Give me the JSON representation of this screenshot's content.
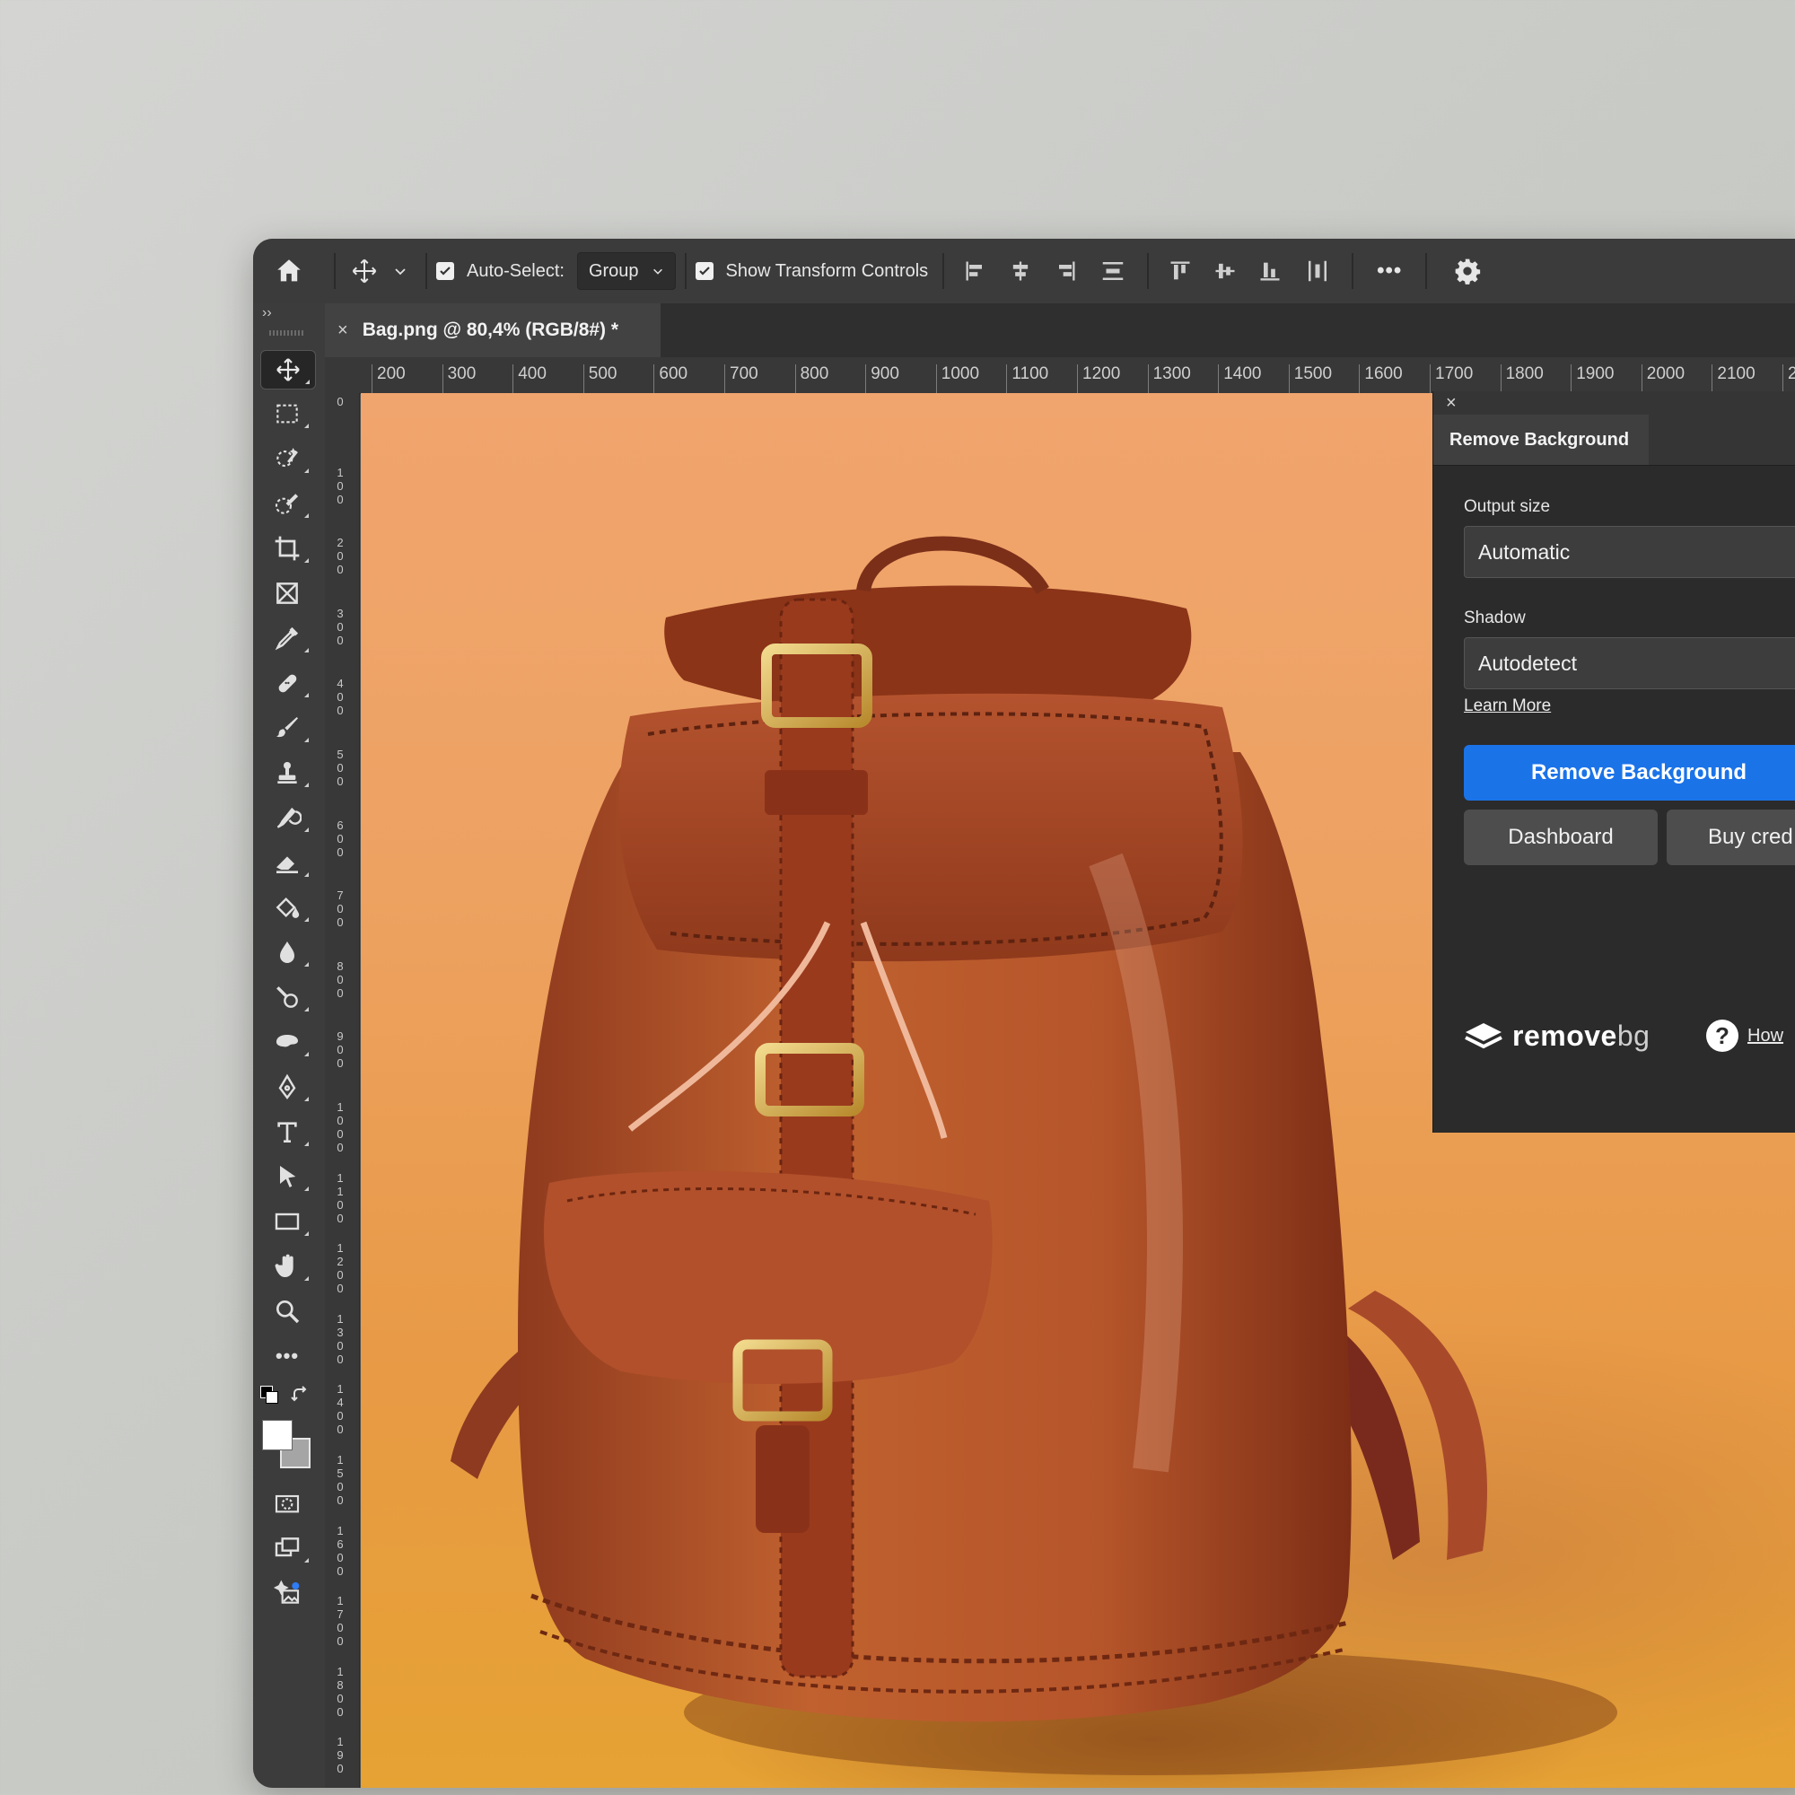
{
  "options_bar": {
    "auto_select_label": "Auto-Select:",
    "auto_select_value": "Group",
    "show_transform_label": "Show Transform Controls",
    "more_label": "•••"
  },
  "document": {
    "tab_close": "×",
    "tab_title": "Bag.png @ 80,4% (RGB/8#) *"
  },
  "rulers": {
    "top": [
      "200",
      "300",
      "400",
      "500",
      "600",
      "700",
      "800",
      "900",
      "1000",
      "1100",
      "1200",
      "1300",
      "1400",
      "1500",
      "1600",
      "1700",
      "1800",
      "1900",
      "2000",
      "2100",
      "2"
    ],
    "left": [
      [
        "0"
      ],
      [
        "1",
        "0",
        "0"
      ],
      [
        "2",
        "0",
        "0"
      ],
      [
        "3",
        "0",
        "0"
      ],
      [
        "4",
        "0",
        "0"
      ],
      [
        "5",
        "0",
        "0"
      ],
      [
        "6",
        "0",
        "0"
      ],
      [
        "7",
        "0",
        "0"
      ],
      [
        "8",
        "0",
        "0"
      ],
      [
        "9",
        "0",
        "0"
      ],
      [
        "1",
        "0",
        "0",
        "0"
      ],
      [
        "1",
        "1",
        "0",
        "0"
      ],
      [
        "1",
        "2",
        "0",
        "0"
      ],
      [
        "1",
        "3",
        "0",
        "0"
      ],
      [
        "1",
        "4",
        "0",
        "0"
      ],
      [
        "1",
        "5",
        "0",
        "0"
      ],
      [
        "1",
        "6",
        "0",
        "0"
      ],
      [
        "1",
        "7",
        "0",
        "0"
      ],
      [
        "1",
        "8",
        "0",
        "0"
      ],
      [
        "1",
        "9",
        "0"
      ]
    ]
  },
  "tools_panel": {
    "collapse_label": "››",
    "more_tools_label": "•••"
  },
  "plugin": {
    "close_label": "×",
    "tab_label": "Remove Background",
    "output_size_label": "Output size",
    "output_size_value": "Automatic",
    "shadow_label": "Shadow",
    "shadow_value": "Autodetect",
    "learn_more": "Learn More",
    "remove_button": "Remove Background",
    "dashboard_button": "Dashboard",
    "buy_button": "Buy cred",
    "brand_strong": "remove",
    "brand_light": "bg",
    "help_q": "?",
    "help_link": "How"
  },
  "colors": {
    "primary_button": "#1b73e8",
    "panel_bg": "#2b2b2b",
    "app_bg": "#535353",
    "leather": "#b3552d"
  }
}
